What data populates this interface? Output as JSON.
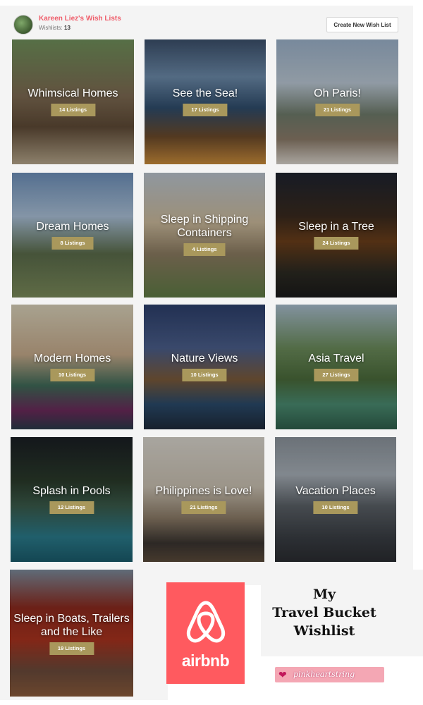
{
  "header": {
    "username": "Kareen Liez's Wish Lists",
    "wishlists_label": "Wishlists:",
    "wishlists_count": "13",
    "create_button": "Create New Wish List"
  },
  "tiles": [
    {
      "title": "Whimsical Homes",
      "listings": "14 Listings"
    },
    {
      "title": "See the Sea!",
      "listings": "17 Listings"
    },
    {
      "title": "Oh Paris!",
      "listings": "21 Listings"
    },
    {
      "title": "Dream Homes",
      "listings": "8 Listings"
    },
    {
      "title": "Sleep in Shipping Containers",
      "listings": "4 Listings"
    },
    {
      "title": "Sleep in a Tree",
      "listings": "24 Listings"
    },
    {
      "title": "Modern Homes",
      "listings": "10 Listings"
    },
    {
      "title": "Nature Views",
      "listings": "10 Listings"
    },
    {
      "title": "Asia Travel",
      "listings": "27 Listings"
    },
    {
      "title": "Splash in Pools",
      "listings": "12 Listings"
    },
    {
      "title": "Philippines is Love!",
      "listings": "21 Listings"
    },
    {
      "title": "Vacation Places",
      "listings": "10 Listings"
    },
    {
      "title": "Sleep in Boats, Trailers and the Like",
      "listings": "19 Listings"
    }
  ],
  "promo": {
    "logo_word": "airbnb",
    "line1": "My",
    "line2": "Travel Bucket",
    "line3": "Wishlist",
    "ribbon_text": "pinkheartstring",
    "logo_icon": "airbnb-belo-icon",
    "ribbon_icon": "heart-icon"
  },
  "colors": {
    "accent": "#ef5d6a",
    "badge": "#a9985c",
    "airbnb": "#ff5a5f",
    "ribbon": "#f4a7b4"
  }
}
